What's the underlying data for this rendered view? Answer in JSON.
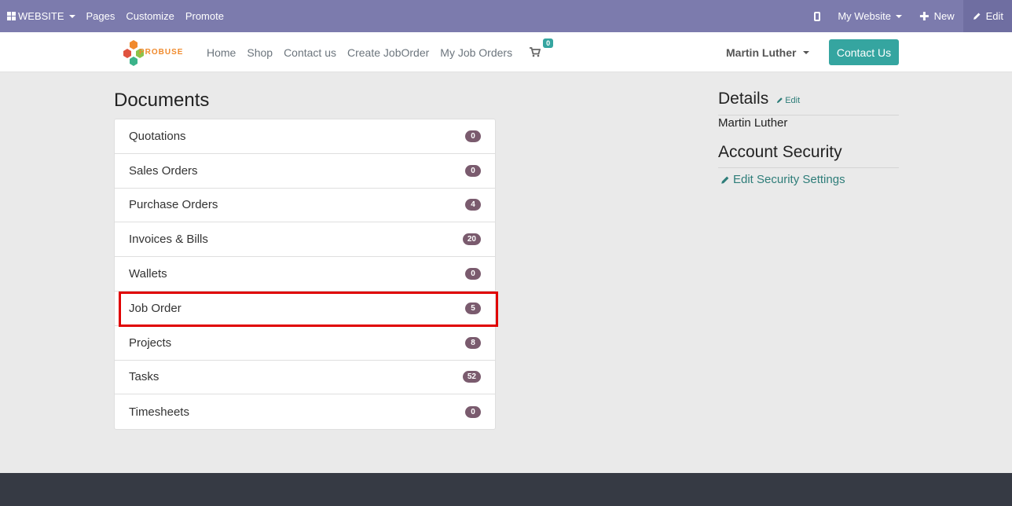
{
  "admin_bar": {
    "apps_label": "WEBSITE",
    "menu": [
      "Pages",
      "Customize",
      "Promote"
    ],
    "website_label": "My Website",
    "new_label": "New",
    "edit_label": "Edit"
  },
  "header": {
    "logo_text": "PROBUSE",
    "nav": [
      "Home",
      "Shop",
      "Contact us",
      "Create JobOrder",
      "My Job Orders"
    ],
    "cart_count": "0",
    "user_name": "Martin Luther",
    "contact_button": "Contact Us"
  },
  "documents": {
    "title": "Documents",
    "items": [
      {
        "label": "Quotations",
        "count": "0"
      },
      {
        "label": "Sales Orders",
        "count": "0"
      },
      {
        "label": "Purchase Orders",
        "count": "4"
      },
      {
        "label": "Invoices & Bills",
        "count": "20"
      },
      {
        "label": "Wallets",
        "count": "0"
      },
      {
        "label": "Job Order",
        "count": "5"
      },
      {
        "label": "Projects",
        "count": "8"
      },
      {
        "label": "Tasks",
        "count": "52"
      },
      {
        "label": "Timesheets",
        "count": "0"
      }
    ]
  },
  "details": {
    "title": "Details",
    "edit_label": "Edit",
    "name": "Martin Luther"
  },
  "security": {
    "title": "Account Security",
    "link_label": "Edit Security Settings"
  },
  "colors": {
    "admin_bar": "#7c7bad",
    "accent": "#35a5a0",
    "badge": "#7a5b6e",
    "highlight": "#e00000",
    "footer": "#363a44"
  }
}
